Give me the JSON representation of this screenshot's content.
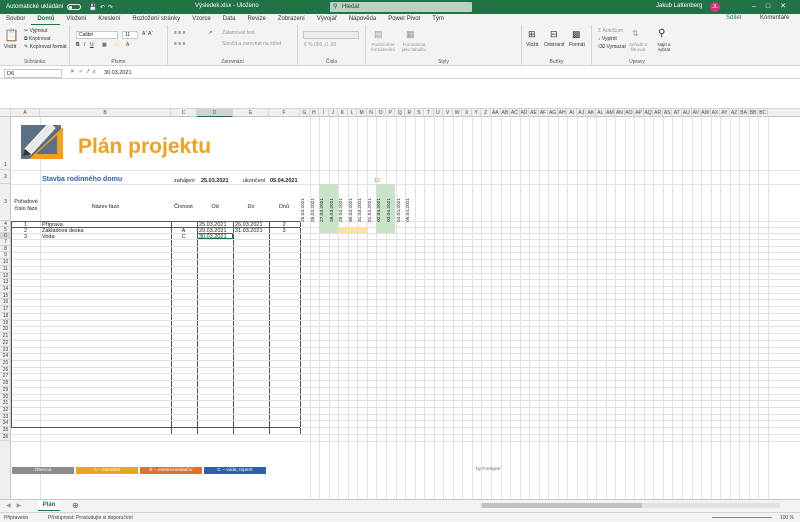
{
  "titlebar": {
    "autosave_label": "Automatické ukládání",
    "document": "Výsledek.xlsx - Uloženo",
    "search_placeholder": "Hledat",
    "user": "Jakub Lattenberg",
    "avatar_initials": "JL"
  },
  "tabs": [
    "Soubor",
    "Domů",
    "Vložení",
    "Kreslení",
    "Rozložení stránky",
    "Vzorce",
    "Data",
    "Revize",
    "Zobrazení",
    "Vývojář",
    "Nápověda",
    "Power Pivot",
    "Tým"
  ],
  "active_tab": "Domů",
  "tab_actions": {
    "share": "Sdílet",
    "comments": "Komentáře"
  },
  "ribbon": {
    "clipboard": {
      "paste": "Vložit",
      "cut": "Vyjmout",
      "copy": "Kopírovat",
      "format_painter": "Kopírovat formát",
      "label": "Schránka"
    },
    "font": {
      "name": "Calibri",
      "size": "11",
      "label": "Písmo"
    },
    "alignment": {
      "wrap": "Zalamovat text",
      "merge": "Sloučit a zarovnat na střed",
      "label": "Zarovnání"
    },
    "number": {
      "label": "Číslo"
    },
    "styles": {
      "conditional": "Podmíněné formátování",
      "table": "Formátovat jako tabulku",
      "label": "Styly"
    },
    "cells": {
      "insert": "Vložit",
      "delete": "Odstranit",
      "format": "Formát",
      "label": "Buňky"
    },
    "editing": {
      "autosum": "AutoSum",
      "fill": "Vyplnit",
      "clear": "Vymazat",
      "sort": "Seřadit a filtrovat",
      "find": "Najít a vybrat",
      "label": "Úpravy"
    }
  },
  "formula_bar": {
    "name_box": "D6",
    "value": "30.03.2021"
  },
  "columns": [
    "A",
    "B",
    "C",
    "D",
    "E",
    "F",
    "G",
    "H",
    "I",
    "J",
    "K",
    "L",
    "M",
    "N",
    "O",
    "P",
    "Q",
    "R",
    "S",
    "T",
    "U",
    "V",
    "W",
    "X",
    "Y",
    "Z",
    "AA",
    "AB",
    "AC",
    "AD",
    "AE",
    "AF",
    "AG",
    "AH",
    "AI",
    "AJ",
    "AK",
    "AL",
    "AM",
    "AN",
    "AO",
    "AP",
    "AQ",
    "AR",
    "AS",
    "AT",
    "AU",
    "AV",
    "AW",
    "AX",
    "AY",
    "AZ",
    "BA",
    "BB",
    "BC"
  ],
  "selected_column": "D",
  "selected_row": "6",
  "rows": [
    "1",
    "2",
    "3",
    "4",
    "5",
    "6",
    "7",
    "8",
    "9",
    "10",
    "11",
    "12",
    "13",
    "14",
    "15",
    "16",
    "17",
    "18",
    "19",
    "20",
    "21",
    "22",
    "23",
    "24",
    "25",
    "26",
    "27",
    "28",
    "29",
    "30",
    "31",
    "32",
    "33",
    "34",
    "35",
    "36"
  ],
  "sheet": {
    "title": "Plán projektu",
    "project_name": "Stavba rodinného domu",
    "start_label": "zahájení",
    "start_value": "25.03.2021",
    "end_label": "ukončení",
    "end_value": "05.04.2021",
    "today_marker": "12",
    "headers": {
      "order": "Pořadové číslo fáze",
      "name": "Název fáze",
      "activity": "Činnost",
      "from": "Od",
      "to": "Do",
      "days": "Dnů"
    },
    "phases": [
      {
        "num": "1",
        "name": "Příprava",
        "activity": "",
        "from": "25.03.2021",
        "to": "26.03.2021",
        "days": "2"
      },
      {
        "num": "2",
        "name": "Základová deska",
        "activity": "A",
        "from": "29.03.2021",
        "to": "31.03.2021",
        "days": "3"
      },
      {
        "num": "3",
        "name": "Voda",
        "activity": "C",
        "from": "30.03.2021",
        "to": "",
        "days": ""
      }
    ],
    "dates": [
      "25.03.2021",
      "26.03.2021",
      "27.03.2021",
      "28.03.2021",
      "29.03.2021",
      "30.03.2021",
      "31.03.2021",
      "01.04.2021",
      "02.04.2021",
      "03.04.2021",
      "04.04.2021",
      "05.04.2021"
    ],
    "legend": [
      {
        "label": "Obecná",
        "color": "#8c8c8c"
      },
      {
        "label": "A – stavební",
        "color": "#f2a01f"
      },
      {
        "label": "B – elektroinstalační",
        "color": "#e0712a"
      },
      {
        "label": "C – voda, topení",
        "color": "#2f5fb3"
      }
    ],
    "credit": "by Freegok"
  },
  "sheet_tab": "Plán",
  "status": {
    "ready": "Připraveno",
    "accessibility": "Přístupnost: Prostudujte si doporučení",
    "zoom": "100 %"
  },
  "colors": {
    "excel_green": "#217346",
    "title_orange": "#f2a01f",
    "project_blue": "#2f5fb3",
    "weekend_green": "#c9e2c8",
    "gantt_yellow": "#fce2a2"
  }
}
